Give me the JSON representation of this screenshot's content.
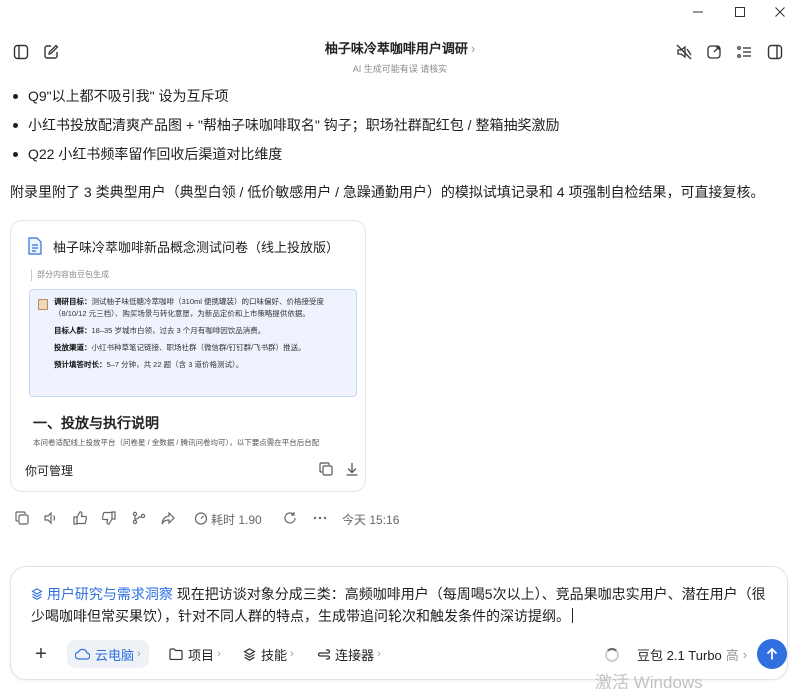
{
  "window": {
    "minimize": "—",
    "maximize": "☐",
    "close": "✕"
  },
  "header": {
    "title": "柚子味冷萃咖啡用户调研",
    "title_chevron": "›",
    "subtitle": "AI 生成可能有误 请核实"
  },
  "content": {
    "bullets": [
      "Q9\"以上都不吸引我\" 设为互斥项",
      "小红书投放配清爽产品图 + \"帮柚子味咖啡取名\" 钩子；职场社群配红包 / 整箱抽奖激励",
      "Q22 小红书频率留作回收后渠道对比维度"
    ],
    "appendix": "附录里附了 3 类典型用户（典型白领 / 低价敏感用户 / 急躁通勤用户）的模拟试填记录和 4 项强制自检结果，可直接复核。"
  },
  "doc_card": {
    "title": "柚子味冷萃咖啡新品概念测试问卷（线上投放版）",
    "note": "部分内容由豆包生成",
    "paragraphs": [
      {
        "label": "调研目标：",
        "text": "测试柚子味低糖冷萃咖啡（310ml 便携罐装）的口味偏好、价格接受度（8/10/12 元三档）、购买场景与转化意愿，为新品定价和上市策略提供依据。"
      },
      {
        "label": "目标人群：",
        "text": "18–35 岁城市白领，过去 3 个月有咖啡因饮品消费。"
      },
      {
        "label": "投放渠道：",
        "text": "小红书种草笔记链接、职场社群（微信群/钉钉群/飞书群）推送。"
      },
      {
        "label": "预计填答时长：",
        "text": "5–7 分钟，共 22 题（含 3 道价格测试）。"
      }
    ],
    "section_heading": "一、投放与执行说明",
    "section_text": "本问卷适配线上投放平台（问卷星 / 金数据 / 腾讯问卷均可），以下要点需在平台后台配",
    "footer_label": "你可管理"
  },
  "actions": {
    "time_cost": "耗时 1.90",
    "timestamp": "今天 15:16"
  },
  "composer": {
    "skill_tag": "用户研究与需求洞察",
    "prompt_text": "现在把访谈对象分成三类：高频咖啡用户（每周喝5次以上）、竞品果咖忠实用户、潜在用户（很少喝咖啡但常买果饮），针对不同人群的特点，生成带追问轮次和触发条件的深访提纲。",
    "plus": "+",
    "pills": {
      "cloud_pc": "云电脑",
      "project": "项目",
      "skills": "技能",
      "connector": "连接器"
    },
    "pill_chevron": "›",
    "model_name": "豆包 2.1 Turbo",
    "model_tier": "高",
    "model_chevron": "›"
  },
  "watermark": "激活 Windows",
  "colors": {
    "accent": "#2f6fe0",
    "pill_active_bg": "#eef1f6",
    "preview_bg": "#eef3fd"
  }
}
